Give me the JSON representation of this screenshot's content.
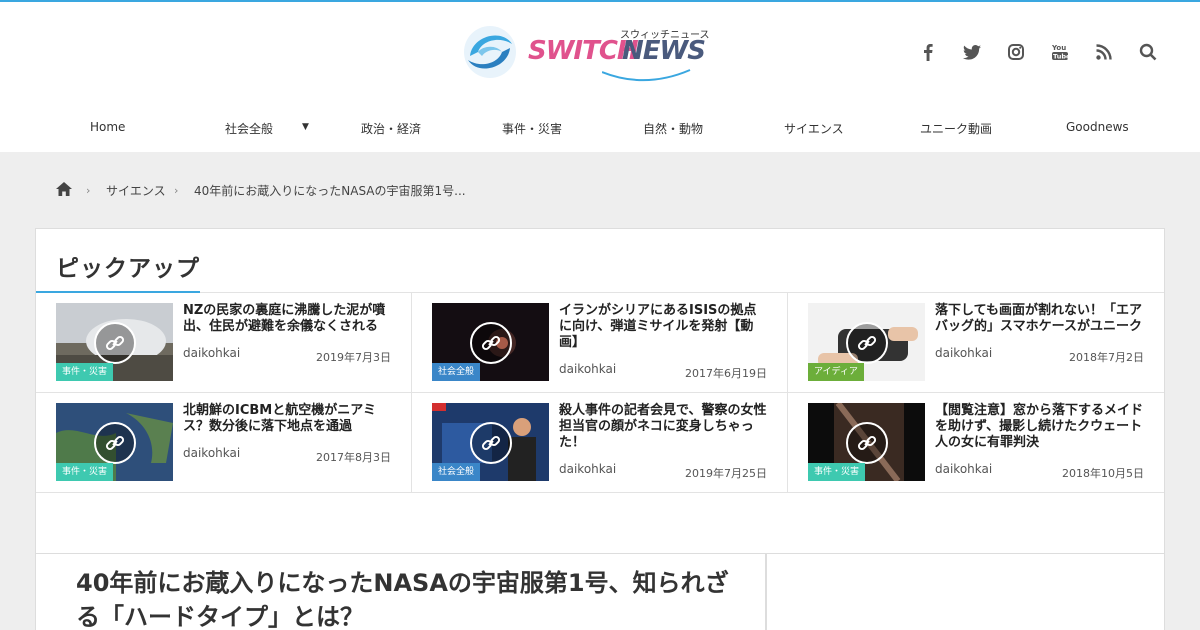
{
  "colors": {
    "accent": "#3aa7e0",
    "logo_pink": "#e0528d",
    "logo_navy": "#4a5a7d",
    "badge": "#3ec9b0"
  },
  "logo": {
    "word1": "SWITCH",
    "word2": "NEWS",
    "kana": "スウィッチニュース"
  },
  "social": [
    "facebook-icon",
    "twitter-icon",
    "instagram-icon",
    "youtube-icon",
    "rss-icon",
    "search-icon"
  ],
  "nav": {
    "items": [
      "Home",
      "社会全般",
      "政治・経済",
      "事件・災害",
      "自然・動物",
      "サイエンス",
      "ユニーク動画",
      "Goodnews"
    ]
  },
  "breadcrumb": {
    "home_icon": "home-icon",
    "category": "サイエンス",
    "current": "40年前にお蔵入りになったNASAの宇宙服第1号..."
  },
  "pickup": {
    "heading": "ピックアップ",
    "cards": [
      {
        "title": "NZの民家の裏庭に沸騰した泥が噴出、住民が避難を余儀なくされる",
        "author": "daikohkai",
        "date": "2019年7月3日",
        "category": "事件・災害"
      },
      {
        "title": "イランがシリアにあるISISの拠点に向け、弾道ミサイルを発射【動画】",
        "author": "daikohkai",
        "date": "2017年6月19日",
        "category": "社会全般"
      },
      {
        "title": "落下しても画面が割れない！「エアバッグ的」スマホケースがユニーク",
        "author": "daikohkai",
        "date": "2018年7月2日",
        "category": "アイディア"
      },
      {
        "title": "北朝鮮のICBMと航空機がニアミス？数分後に落下地点を通過",
        "author": "daikohkai",
        "date": "2017年8月3日",
        "category": "事件・災害"
      },
      {
        "title": "殺人事件の記者会見で、警察の女性担当官の顔がネコに変身しちゃった！",
        "author": "daikohkai",
        "date": "2019年7月25日",
        "category": "社会全般"
      },
      {
        "title": "【閲覧注意】窓から落下するメイドを助けず、撮影し続けたクウェート人の女に有罪判決",
        "author": "daikohkai",
        "date": "2018年10月5日",
        "category": "事件・災害"
      }
    ]
  },
  "article": {
    "title": "40年前にお蔵入りになったNASAの宇宙服第1号、知られざる「ハードタイプ」とは？"
  }
}
